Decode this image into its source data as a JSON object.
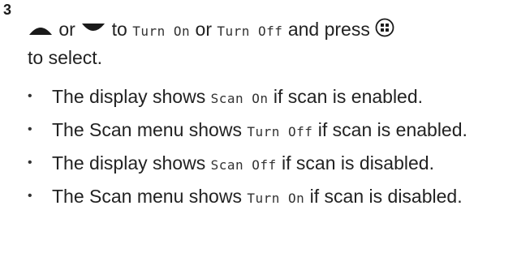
{
  "step": {
    "number": "3",
    "line_parts": {
      "or": " or ",
      "to": " to ",
      "turn_on": "Turn On",
      "or_2": " or ",
      "turn_off": "Turn Off",
      "and_press": " and press ",
      "to_select": "to select."
    },
    "icons": {
      "up": "up-arrow-icon",
      "down": "down-arrow-icon",
      "menu_ok": "menu-ok-button-icon"
    }
  },
  "bullets": [
    {
      "pre": "The display shows ",
      "mono": "Scan On",
      "post": " if scan is enabled."
    },
    {
      "pre": "The Scan menu shows ",
      "mono": "Turn Off",
      "post": " if scan is enabled."
    },
    {
      "pre": "The display shows ",
      "mono": "Scan Off",
      "post": " if scan is disabled."
    },
    {
      "pre": "The Scan menu shows ",
      "mono": "Turn On",
      "post": " if scan is disabled."
    }
  ],
  "bullet_char": "•",
  "colors": {
    "text": "#222222",
    "icon": "#1a1a1a"
  }
}
